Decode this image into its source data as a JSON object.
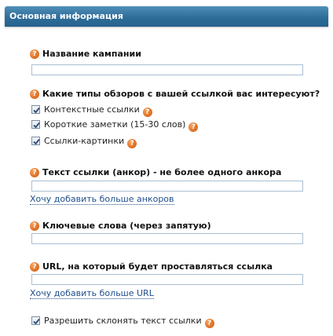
{
  "panel": {
    "title": "Основная информация"
  },
  "campaign": {
    "label": "Название кампании",
    "value": ""
  },
  "review_types": {
    "label": "Какие типы обзоров с вашей ссылкой вас интересуют?",
    "options": [
      {
        "label": "Контекстные ссылки",
        "checked": true
      },
      {
        "label": "Короткие заметки (15-30 слов)",
        "checked": true
      },
      {
        "label": "Ссылки-картинки",
        "checked": true
      }
    ]
  },
  "anchor": {
    "label": "Текст ссылки (анкор) - не более одного анкора",
    "value": "",
    "add_link": "Хочу добавить больше анкоров"
  },
  "keywords": {
    "label": "Ключевые слова (через запятую)",
    "value": ""
  },
  "url": {
    "label": "URL, на который будет проставляться ссылка",
    "value": "",
    "add_link": "Хочу добавить больше URL"
  },
  "decline": {
    "label": "Разрешить склонять текст ссылки",
    "checked": true
  },
  "help_glyph": "?",
  "colors": {
    "header": "#2f6d99",
    "help_icon": "#e0742a",
    "link": "#1f4f8c"
  }
}
